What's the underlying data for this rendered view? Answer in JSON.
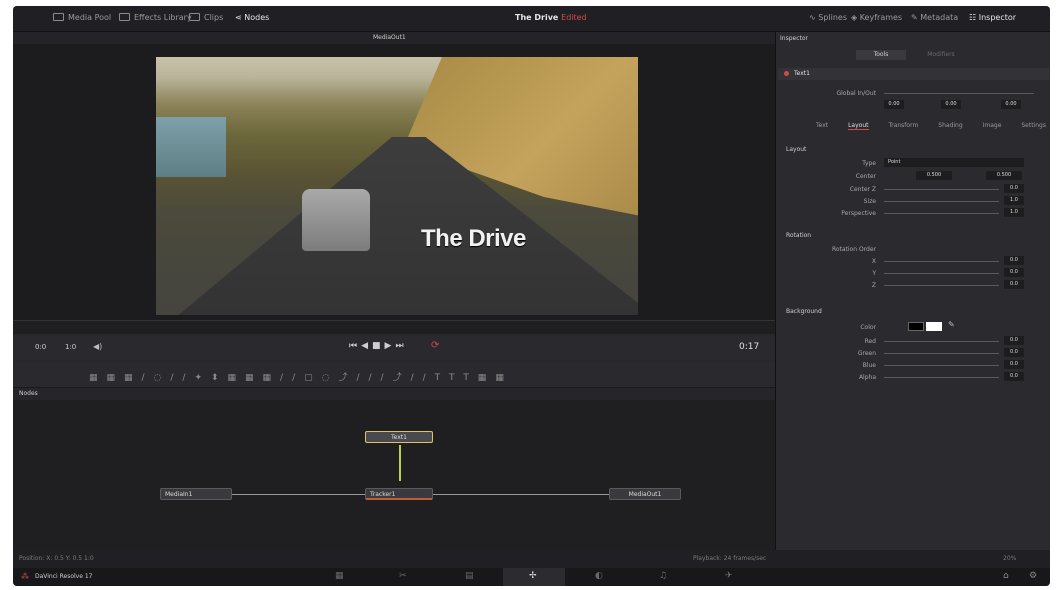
{
  "topbar": {
    "media_pool": "Media Pool",
    "effects_library": "Effects Library",
    "clips": "Clips",
    "nodes": "Nodes",
    "title": "The Drive",
    "title_status": "Edited",
    "splines": "Splines",
    "keyframes": "Keyframes",
    "metadata": "Metadata",
    "inspector": "Inspector"
  },
  "viewer": {
    "label": "MediaOut1",
    "overlay_text": "The Drive",
    "timecode_start": "0:0",
    "timecode_cur": "1:0",
    "timecode_end": "0:17"
  },
  "nodes": {
    "header": "Nodes",
    "text_node": "Text1",
    "media_in": "MediaIn1",
    "tracker": "Tracker1",
    "media_out": "MediaOut1"
  },
  "inspector": {
    "header": "Inspector",
    "tab_tools": "Tools",
    "tab_modifiers": "Modifiers",
    "node_name": "Text1",
    "global_inout": "Global In/Out",
    "in_val": "0.00",
    "mid_val": "0.00",
    "out_val": "0.00",
    "subtabs": [
      "Text",
      "Layout",
      "Transform",
      "Shading",
      "Image",
      "Settings"
    ],
    "layout_section": "Layout",
    "type_label": "Type",
    "type_value": "Point",
    "center_label": "Center",
    "center_x": "0.500",
    "center_y": "0.500",
    "centerz_label": "Center Z",
    "centerz_val": "0.0",
    "size_label": "Size",
    "size_val": "1.0",
    "perspective_label": "Perspective",
    "perspective_val": "1.0",
    "rotation_section": "Rotation",
    "rotation_order": "Rotation Order",
    "x_label": "X",
    "y_label": "Y",
    "z_label": "Z",
    "x_val": "0.0",
    "y_val": "0.0",
    "z_val": "0.0",
    "background_section": "Background",
    "color_label": "Color",
    "red_label": "Red",
    "green_label": "Green",
    "blue_label": "Blue",
    "alpha_label": "Alpha",
    "red_val": "0.0",
    "green_val": "0.0",
    "blue_val": "0.0",
    "alpha_val": "0.0"
  },
  "status": {
    "left": "Position: X: 0.5   Y: 0.5   1:0",
    "right": "Playback: 24 frames/sec",
    "zoom": "20%"
  },
  "pagebar": {
    "app_name": "DaVinci Resolve 17"
  }
}
